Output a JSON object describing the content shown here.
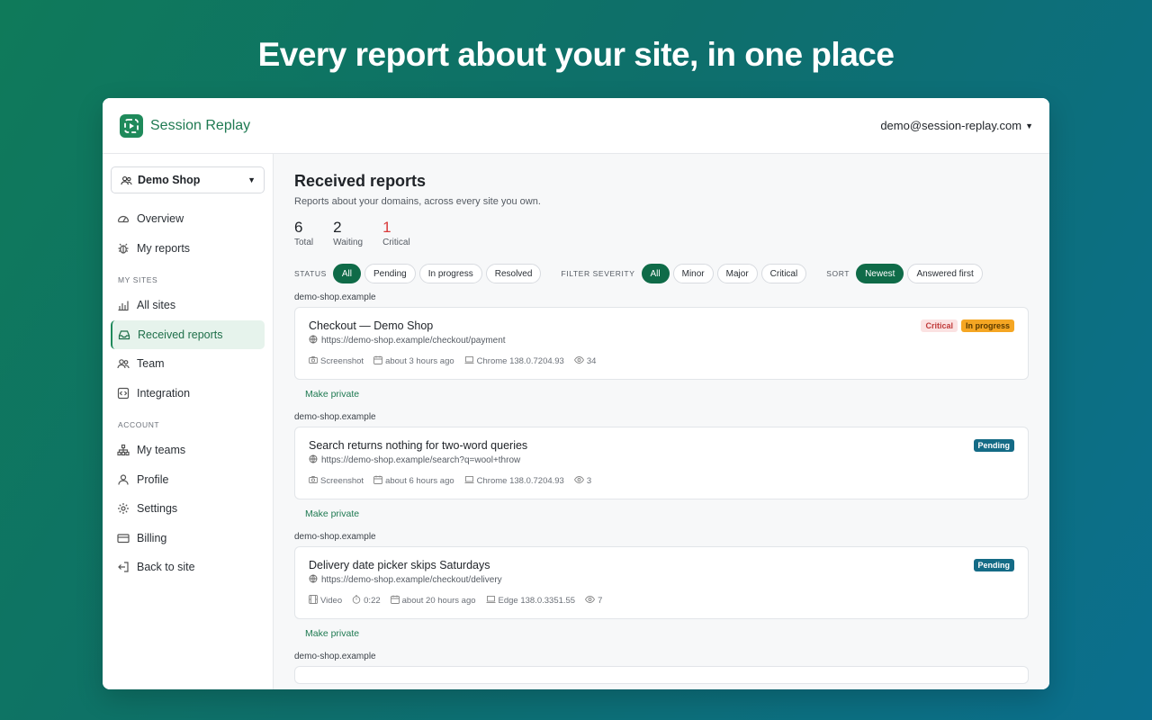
{
  "hero": {
    "title": "Every report about your site, in one place"
  },
  "app": {
    "brand": "Session Replay",
    "user_email": "demo@session-replay.com"
  },
  "sidebar": {
    "org": "Demo Shop",
    "items_top": [
      {
        "label": "Overview",
        "icon": "dashboard-icon"
      },
      {
        "label": "My reports",
        "icon": "bug-icon"
      }
    ],
    "section_sites": "MY SITES",
    "items_sites": [
      {
        "label": "All sites",
        "icon": "chart-icon"
      },
      {
        "label": "Received reports",
        "icon": "inbox-icon",
        "active": true
      },
      {
        "label": "Team",
        "icon": "people-icon"
      },
      {
        "label": "Integration",
        "icon": "code-icon"
      }
    ],
    "section_account": "ACCOUNT",
    "items_account": [
      {
        "label": "My teams",
        "icon": "hierarchy-icon"
      },
      {
        "label": "Profile",
        "icon": "user-icon"
      },
      {
        "label": "Settings",
        "icon": "gear-icon"
      },
      {
        "label": "Billing",
        "icon": "card-icon"
      },
      {
        "label": "Back to site",
        "icon": "exit-icon"
      }
    ]
  },
  "main": {
    "title": "Received reports",
    "subtitle": "Reports about your domains, across every site you own.",
    "stats": [
      {
        "value": "6",
        "label": "Total"
      },
      {
        "value": "2",
        "label": "Waiting"
      },
      {
        "value": "1",
        "label": "Critical"
      }
    ],
    "filters": {
      "status_label": "STATUS",
      "status": [
        "All",
        "Pending",
        "In progress",
        "Resolved"
      ],
      "severity_label": "FILTER SEVERITY",
      "severity": [
        "All",
        "Minor",
        "Major",
        "Critical"
      ],
      "sort_label": "SORT",
      "sort": [
        "Newest",
        "Answered first"
      ]
    },
    "make_private": "Make private",
    "reports": [
      {
        "domain": "demo-shop.example",
        "title": "Checkout — Demo Shop",
        "url": "https://demo-shop.example/checkout/payment",
        "media": "Screenshot",
        "time": "about 3 hours ago",
        "browser": "Chrome 138.0.7204.93",
        "views": "34",
        "badges": [
          {
            "label": "Critical",
            "kind": "critical"
          },
          {
            "label": "In progress",
            "kind": "progress"
          }
        ]
      },
      {
        "domain": "demo-shop.example",
        "title": "Search returns nothing for two-word queries",
        "url": "https://demo-shop.example/search?q=wool+throw",
        "media": "Screenshot",
        "time": "about 6 hours ago",
        "browser": "Chrome 138.0.7204.93",
        "views": "3",
        "badges": [
          {
            "label": "Pending",
            "kind": "pending"
          }
        ]
      },
      {
        "domain": "demo-shop.example",
        "title": "Delivery date picker skips Saturdays",
        "url": "https://demo-shop.example/checkout/delivery",
        "media": "Video",
        "duration": "0:22",
        "time": "about 20 hours ago",
        "browser": "Edge 138.0.3351.55",
        "views": "7",
        "badges": [
          {
            "label": "Pending",
            "kind": "pending"
          }
        ]
      }
    ],
    "next_domain": "demo-shop.example"
  }
}
